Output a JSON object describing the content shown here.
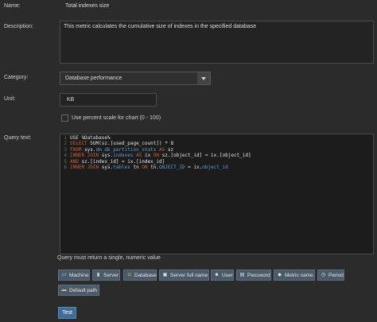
{
  "labels": {
    "name": "Name:",
    "description": "Description:",
    "category": "Category:",
    "unit": "Unit:",
    "query_text": "Query text:"
  },
  "name_value": "Total indexes size",
  "description_value": "This metric calculates the cumulative size of indexes in the specified database",
  "category_value": "Database performance",
  "unit_value": "KB",
  "percent_scale_label": "Use percent scale for chart (0 - 100)",
  "percent_scale_checked": false,
  "query_lines": [
    [
      {
        "t": "USE %Database%",
        "c": "plain"
      }
    ],
    [
      {
        "t": "SELECT ",
        "c": "kw"
      },
      {
        "t": "SUM",
        "c": "fn"
      },
      {
        "t": "(sz.[used_page_count]) * 8",
        "c": "plain"
      }
    ],
    [
      {
        "t": "FROM ",
        "c": "kw"
      },
      {
        "t": "sys.",
        "c": "plain"
      },
      {
        "t": "dm_db_partition_stats",
        "c": "obj"
      },
      {
        "t": " AS ",
        "c": "kw"
      },
      {
        "t": "sz",
        "c": "plain"
      }
    ],
    [
      {
        "t": "INNER JOIN ",
        "c": "kw"
      },
      {
        "t": "sys.",
        "c": "plain"
      },
      {
        "t": "indexes",
        "c": "obj"
      },
      {
        "t": " AS ",
        "c": "kw"
      },
      {
        "t": "ix ",
        "c": "plain"
      },
      {
        "t": "ON ",
        "c": "kw"
      },
      {
        "t": "sz.[object_id] = ix.[object_id]",
        "c": "plain"
      }
    ],
    [
      {
        "t": "AND ",
        "c": "kw"
      },
      {
        "t": "sz.[index_id] = ix.[index_id]",
        "c": "plain"
      }
    ],
    [
      {
        "t": "INNER JOIN ",
        "c": "kw"
      },
      {
        "t": "sys.",
        "c": "plain"
      },
      {
        "t": "tables",
        "c": "obj"
      },
      {
        "t": " tn ",
        "c": "plain"
      },
      {
        "t": "ON ",
        "c": "kw"
      },
      {
        "t": "tn.",
        "c": "plain"
      },
      {
        "t": "OBJECT_ID",
        "c": "obj"
      },
      {
        "t": " = ix.",
        "c": "plain"
      },
      {
        "t": "object_id",
        "c": "obj"
      }
    ]
  ],
  "query_hint": "Query must return a single, numeric value",
  "variable_buttons": [
    {
      "label": "Machine",
      "icon": "machine-icon"
    },
    {
      "label": "Server",
      "icon": "server-icon"
    },
    {
      "label": "Database",
      "icon": "database-icon"
    },
    {
      "label": "Server full name",
      "icon": "server-full-name-icon"
    },
    {
      "label": "User",
      "icon": "user-icon"
    },
    {
      "label": "Password",
      "icon": "password-icon"
    },
    {
      "label": "Metric name",
      "icon": "metric-name-icon"
    },
    {
      "label": "Period",
      "icon": "period-icon"
    },
    {
      "label": "Default path",
      "icon": "folder-icon"
    }
  ],
  "test_label": "Test",
  "colors": {
    "keyword": "#c9603a",
    "object": "#5a9fd4",
    "button": "#4b5a68",
    "test_button": "#3f6d9a"
  }
}
